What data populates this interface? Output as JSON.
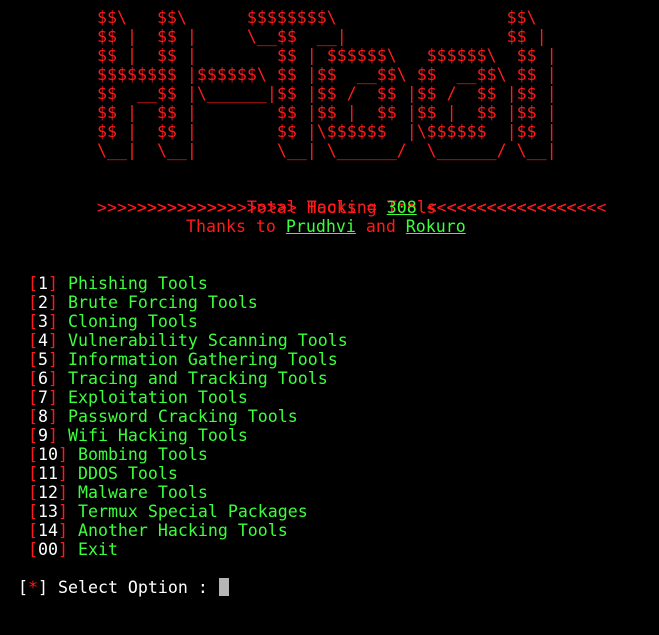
{
  "colors": {
    "background": "#000000",
    "red": "#ff1a1a",
    "green": "#3cff3c",
    "white": "#ffffff",
    "cursor": "#b5b5b5"
  },
  "banner_art": "$$\\   $$\\      $$$$$$$$\\                 $$\\\n$$ |  $$ |     \\__$$  __|                $$ |\n$$ |  $$ |        $$ | $$$$$$\\   $$$$$$\\  $$ |\n$$$$$$$$ |$$$$$$\\ $$ |$$  __$$\\ $$  __$$\\ $$ |\n$$  __$$ |\\______|$$ |$$ /  $$ |$$ /  $$ |$$ |\n$$ |  $$ |        $$ |$$ |  $$ |$$ |  $$ |$$ |\n$$ |  $$ |        $$ |\\$$$$$$  |\\$$$$$$  |$$ |\n\\__|  \\__|        \\__| \\______/  \\______/ \\__|",
  "header": {
    "line1": ">>>>>>>>>>>>>>>> Hacking Tools <<<<<<<<<<<<<<<<",
    "line2_prefix": ">>>>>>>>>>>>>> Total Tools = ",
    "total_tools": "308",
    "line2_suffix": " <<<<<<<<<<<<<<<",
    "thanks_prefix": "Thanks to ",
    "author1": "Prudhvi",
    "thanks_and": " and ",
    "author2": "Rokuro"
  },
  "menu": [
    {
      "num": "1",
      "label": "Phishing Tools"
    },
    {
      "num": "2",
      "label": "Brute Forcing Tools"
    },
    {
      "num": "3",
      "label": "Cloning Tools"
    },
    {
      "num": "4",
      "label": "Vulnerability Scanning Tools"
    },
    {
      "num": "5",
      "label": "Information Gathering Tools"
    },
    {
      "num": "6",
      "label": "Tracing and Tracking Tools"
    },
    {
      "num": "7",
      "label": "Exploitation Tools"
    },
    {
      "num": "8",
      "label": "Password Cracking Tools"
    },
    {
      "num": "9",
      "label": "Wifi Hacking Tools"
    },
    {
      "num": "10",
      "label": "Bombing Tools"
    },
    {
      "num": "11",
      "label": "DDOS Tools"
    },
    {
      "num": "12",
      "label": "Malware Tools"
    },
    {
      "num": "13",
      "label": "Termux Special Packages"
    },
    {
      "num": "14",
      "label": "Another Hacking Tools"
    },
    {
      "num": "00",
      "label": "Exit"
    }
  ],
  "prompt": {
    "bracket_open": "[",
    "star": "*",
    "bracket_close": "]",
    "label": " Select Option : ",
    "input_value": ""
  }
}
